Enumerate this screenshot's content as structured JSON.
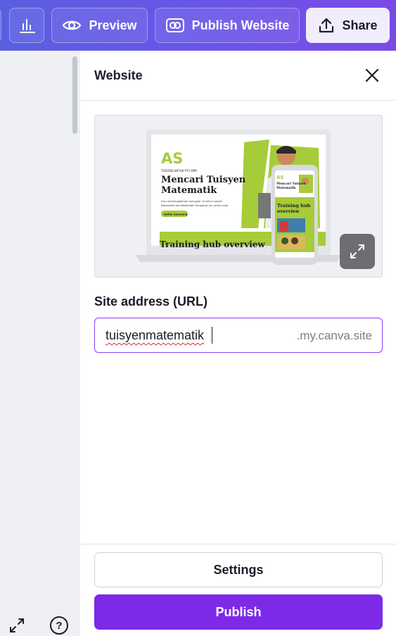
{
  "toolbar": {
    "preview_label": "Preview",
    "publish_website_label": "Publish Website",
    "share_label": "Share"
  },
  "panel": {
    "title": "Website",
    "site_address_label": "Site address (URL)",
    "url_value": "tuisyenmatematik",
    "url_suffix": ".my.canva.site",
    "settings_label": "Settings",
    "publish_label": "Publish"
  },
  "preview": {
    "brand_mark": "AS",
    "eyebrow": "TUISYEN UNTUK PT3 SPM",
    "headline_line1": "Mencari Tuisyen",
    "headline_line2": "Matematik",
    "body_line1": "Guru berpengalaman mengajar 10 tahun subjek",
    "body_line2": "Matematik dan Matematik Tambahan ke rumah anda",
    "cta": "Daftar Sekarang",
    "band_text": "Training hub overview",
    "mobile_headline_line1": "Mencari Tuisyen",
    "mobile_headline_line2": "Matematik",
    "mobile_band_line1": "Training hub",
    "mobile_band_line2": "overview"
  },
  "colors": {
    "accent": "#7d2ae8",
    "topbar_start": "#5a5fe0",
    "topbar_end": "#7a4ae6",
    "brand_green": "#a6cc3a"
  },
  "icons": {
    "chart": "bar-chart-icon",
    "preview": "eye-icon",
    "publish": "globe-link-icon",
    "share": "upload-icon",
    "close": "close-icon",
    "expand": "expand-arrows-icon",
    "help": "question-icon"
  }
}
